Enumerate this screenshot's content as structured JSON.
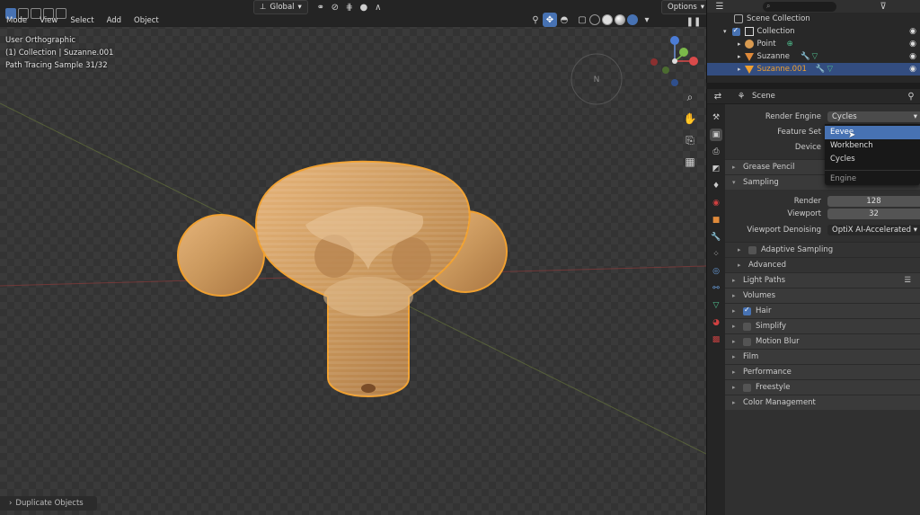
{
  "viewport": {
    "header": {
      "mode": "Mode",
      "menus": [
        "View",
        "Select",
        "Add",
        "Object"
      ],
      "transform_orientation": "Global",
      "options_label": "Options"
    },
    "overlay": {
      "view_name": "User Orthographic",
      "collection_info": "(1) Collection | Suzanne.001",
      "sample_info": "Path Tracing Sample 31/32"
    },
    "gizmo_center_label": "N",
    "status_chip": "Duplicate Objects"
  },
  "outliner": {
    "scene_collection": "Scene Collection",
    "items": [
      {
        "label": "Collection"
      },
      {
        "label": "Point"
      },
      {
        "label": "Suzanne"
      },
      {
        "label": "Suzanne.001"
      }
    ]
  },
  "properties": {
    "header_title": "Scene",
    "render_engine_label": "Render Engine",
    "render_engine_value": "Cycles",
    "feature_set_label": "Feature Set",
    "device_label": "Device",
    "dropdown_options": [
      "Eevee",
      "Workbench",
      "Cycles"
    ],
    "dropdown_caption": "Engine",
    "grease_pencil": "Grease Pencil",
    "sampling": "Sampling",
    "render_label": "Render",
    "render_value": "128",
    "viewport_label": "Viewport",
    "viewport_value": "32",
    "denoising_label": "Viewport Denoising",
    "denoising_value": "OptiX AI-Accelerated",
    "adaptive_sampling": "Adaptive Sampling",
    "advanced": "Advanced",
    "panels": {
      "light_paths": "Light Paths",
      "volumes": "Volumes",
      "hair": "Hair",
      "simplify": "Simplify",
      "motion_blur": "Motion Blur",
      "film": "Film",
      "performance": "Performance",
      "freestyle": "Freestyle",
      "color_management": "Color Management"
    }
  },
  "colors": {
    "accent_blue": "#4772b3",
    "selection_outline": "#f0a030",
    "suzanne_material": "#c9975c"
  }
}
